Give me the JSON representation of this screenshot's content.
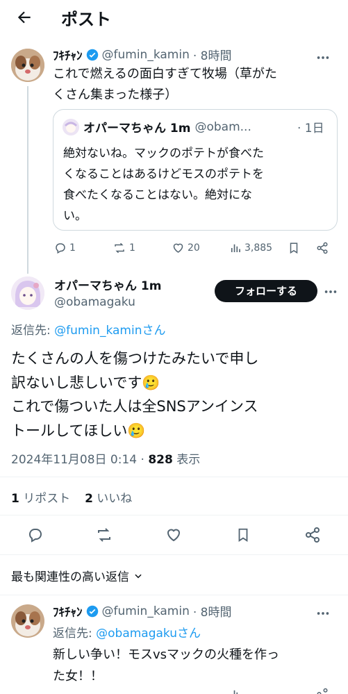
{
  "header": {
    "title": "ポスト"
  },
  "parent_post": {
    "name": "ﾌｷﾁｬﾝ",
    "handle": "@fumin_kamin",
    "time": "· 8時間",
    "text_line1": "これで燃えるの面白すぎて牧場（草がた",
    "text_line2": "くさん集まった様子）",
    "quote": {
      "name": "オパーマちゃん 1m",
      "handle": "@obam...",
      "time": "· 1日",
      "text_line1": "絶対ないね。マックのポテトが食べた",
      "text_line2": "くなることはあるけどモスのポテトを",
      "text_line3": "食べたくなることはない。絶対にな",
      "text_line4": "い。"
    },
    "actions": {
      "replies": "1",
      "reposts": "1",
      "likes": "20",
      "views": "3,885"
    }
  },
  "main_post": {
    "name": "オパーマちゃん 1m",
    "handle": "@obamagaku",
    "follow_label": "フォローする",
    "reply_to_prefix": "返信先: ",
    "reply_to_handle": "@fumin_kaminさん",
    "text_line1": "たくさんの人を傷つけたみたいで申し",
    "text_line2": "訳ないし悲しいです🥲",
    "text_line3": "これで傷ついた人は全SNSアンインス",
    "text_line4": "トールしてほしい🥲",
    "date": "2024年11月08日 0:14 · ",
    "views_count": "828",
    "views_label": " 表示",
    "reposts_count": "1",
    "reposts_label": " リポスト",
    "likes_count": "2",
    "likes_label": " いいね"
  },
  "sort": {
    "label": "最も関連性の高い返信"
  },
  "reply_post": {
    "name": "ﾌｷﾁｬﾝ",
    "handle": "@fumin_kamin",
    "time": "· 8時間",
    "reply_to_prefix": "返信先: ",
    "reply_to_handle": "@obamagakuさん",
    "text_line1": "新しい争い！モスvsマックの火種を作っ",
    "text_line2": "た女！！"
  },
  "colors": {
    "accent": "#1d9bf0",
    "text": "#0f1419",
    "muted": "#536471",
    "border": "#eff3f4",
    "verified": "#1d9bf0"
  }
}
